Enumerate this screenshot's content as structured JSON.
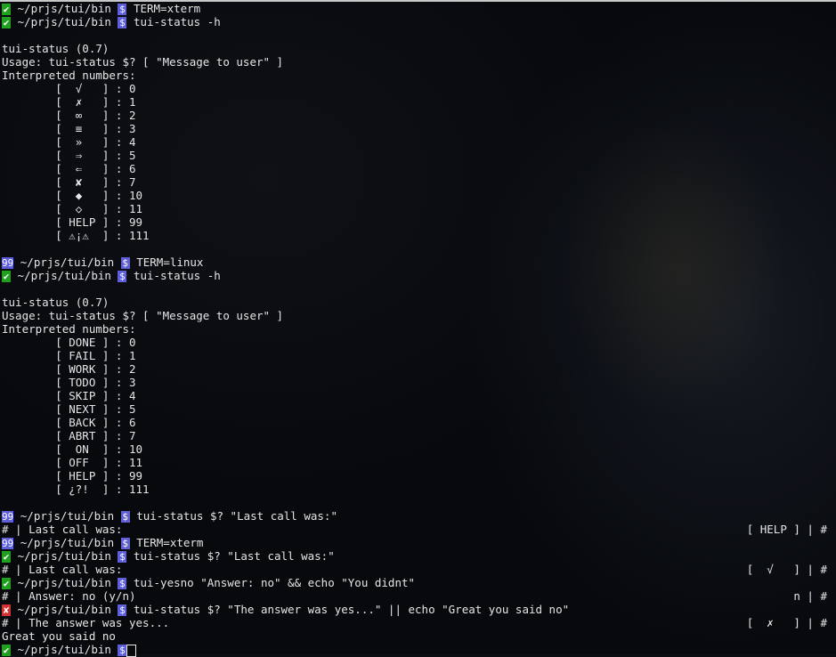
{
  "terminal": {
    "prompt_path": "~/prjs/tui/bin",
    "prompt_dollar": "$",
    "colors": {
      "ok": "#1fa01f",
      "fail": "#d23232",
      "code": "#5f5fd7"
    }
  },
  "badges": {
    "ok": "✔",
    "fail": "✘",
    "code99": "99",
    "dollar": "$"
  },
  "cmd1": "TERM=xterm",
  "cmd2": "tui-status -h",
  "help1": {
    "version": "tui-status (0.7)",
    "usage": "Usage: tui-status $? [ \"Message to user\" ]",
    "header": "Interpreted numbers:",
    "rows": [
      "        [  √   ] : 0",
      "        [  ✗   ] : 1",
      "        [  ∞   ] : 2",
      "        [  ≡   ] : 3",
      "        [  »   ] : 4",
      "        [  ⇒   ] : 5",
      "        [  ⇐   ] : 6",
      "        [  ✘   ] : 7",
      "        [  ◆   ] : 10",
      "        [  ◇   ] : 11",
      "        [ HELP ] : 99",
      "        [ ⚠¡⚠  ] : 111"
    ]
  },
  "cmd3": "TERM=linux",
  "cmd4": "tui-status -h",
  "help2": {
    "version": "tui-status (0.7)",
    "usage": "Usage: tui-status $? [ \"Message to user\" ]",
    "header": "Interpreted numbers:",
    "rows": [
      "        [ DONE ] : 0",
      "        [ FAIL ] : 1",
      "        [ WORK ] : 2",
      "        [ TODO ] : 3",
      "        [ SKIP ] : 4",
      "        [ NEXT ] : 5",
      "        [ BACK ] : 6",
      "        [ ABRT ] : 7",
      "        [  ON  ] : 10",
      "        [ OFF  ] : 11",
      "        [ HELP ] : 99",
      "        [ ¿?!  ] : 111"
    ]
  },
  "cmd5": "tui-status $? \"Last call was:\"",
  "out5_left": "# | Last call was:",
  "out5_right": "[ HELP ] | #",
  "cmd6": "TERM=xterm",
  "cmd7": "tui-status $? \"Last call was:\"",
  "out7_left": "# | Last call was:",
  "out7_right": "[  √   ] | #",
  "cmd8": "tui-yesno \"Answer: no\" && echo \"You didnt\"",
  "out8_left": "# | Answer: no (y/n)",
  "out8_right": "n | #",
  "cmd9": "tui-status $? \"The answer was yes...\" || echo \"Great you said no\"",
  "out9_left": "# | The answer was yes...",
  "out9_right": "[  ✗   ] | #",
  "out9_extra": "Great you said no"
}
